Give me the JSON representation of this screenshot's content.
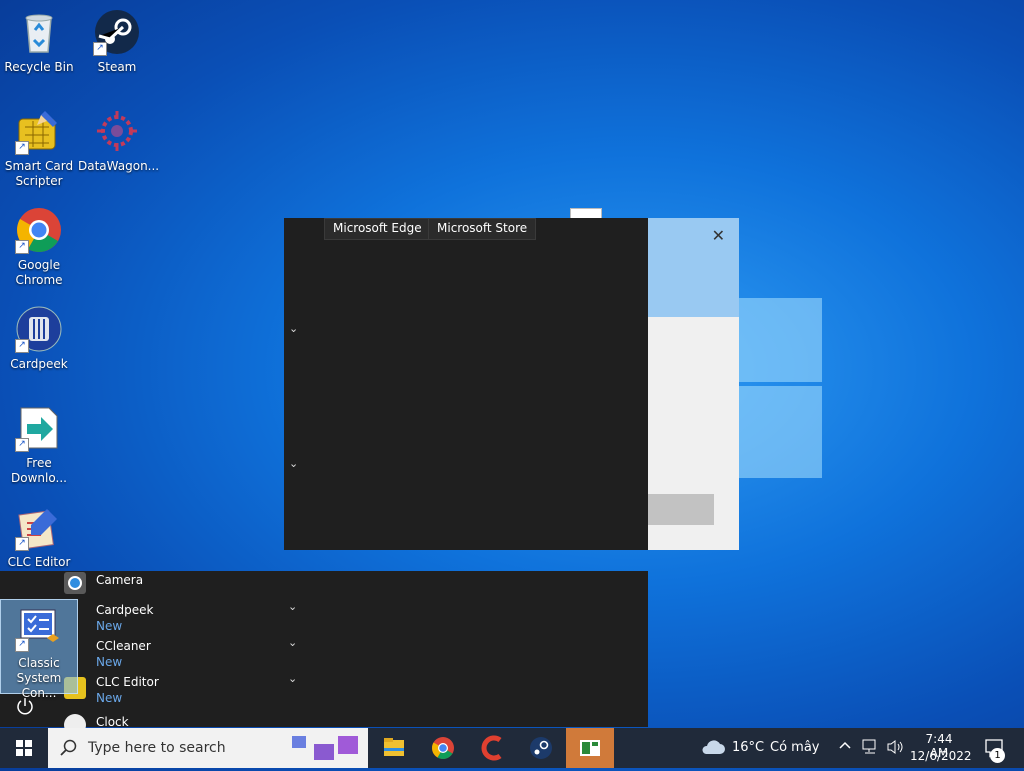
{
  "desktop": {
    "icons": [
      {
        "label": "Recycle Bin"
      },
      {
        "label": "Steam"
      },
      {
        "label": "Smart Card Scripter"
      },
      {
        "label": "DataWagon..."
      },
      {
        "label": "Google Chrome"
      },
      {
        "label": "Cardpeek"
      },
      {
        "label": "Free Downlo..."
      },
      {
        "label": "CLC Editor"
      },
      {
        "label": "Classic System Con..."
      }
    ]
  },
  "flyout": {
    "tooltip_1": "Microsoft Edge",
    "tooltip_2": "Microsoft Store"
  },
  "dialog": {
    "close_glyph": "✕"
  },
  "start_menu": {
    "apps": [
      {
        "name": "Camera",
        "badge": ""
      },
      {
        "name": "Cardpeek",
        "badge": "New"
      },
      {
        "name": "CCleaner",
        "badge": "New"
      },
      {
        "name": "CLC Editor",
        "badge": "New"
      },
      {
        "name": "Clock",
        "badge": ""
      }
    ],
    "power_icon": "power-icon"
  },
  "taskbar": {
    "search_placeholder": "Type here to search",
    "weather_temp": "16°C",
    "weather_desc": "Có mây",
    "time": "7:44 AM",
    "date": "12/6/2022",
    "notification_count": "1"
  },
  "colors": {
    "taskbar_bg": "#202a3a",
    "start_bg": "#1f1f1f",
    "accent_new": "#6aa7e8"
  }
}
